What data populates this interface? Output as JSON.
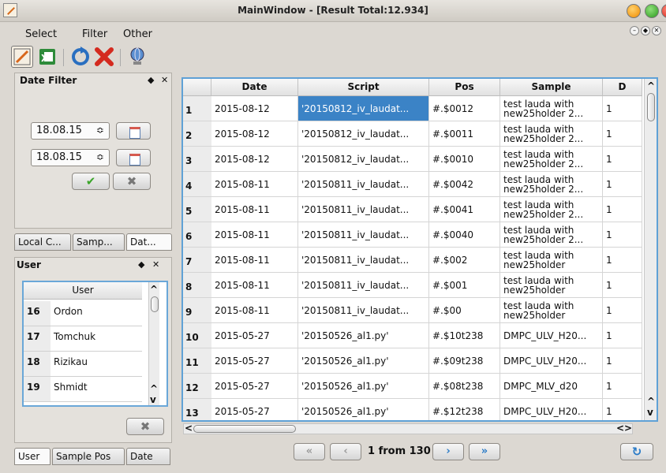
{
  "window": {
    "title": "MainWindow - [Result Total:12.934]"
  },
  "menu": [
    "Select",
    "Filter",
    "Other"
  ],
  "date_filter": {
    "title": "Date Filter",
    "from_date": "18.08.15",
    "to_date": "18.08.15",
    "apply_label": "✔",
    "clear_label": "✖"
  },
  "filter_tabs": [
    "Local C...",
    "Samp...",
    "Dat..."
  ],
  "user_panel": {
    "title": "User",
    "column": "User",
    "rows": [
      {
        "num": "16",
        "name": "Ordon"
      },
      {
        "num": "17",
        "name": "Tomchuk"
      },
      {
        "num": "18",
        "name": "Rizikau"
      },
      {
        "num": "19",
        "name": "Shmidt"
      }
    ],
    "clear_label": "✖"
  },
  "bottom_tabs": [
    "User",
    "Sample Pos",
    "Date"
  ],
  "table": {
    "columns": [
      "Date",
      "Script",
      "Pos",
      "Sample",
      "D"
    ],
    "rows": [
      {
        "num": "1",
        "date": "2015-08-12",
        "script": "'20150812_iv_laudat...",
        "pos": "#.$0012",
        "sample": "test lauda with new25holder 2...",
        "d": "1"
      },
      {
        "num": "2",
        "date": "2015-08-12",
        "script": "'20150812_iv_laudat...",
        "pos": "#.$0011",
        "sample": "test lauda with new25holder 2...",
        "d": "1"
      },
      {
        "num": "3",
        "date": "2015-08-12",
        "script": "'20150812_iv_laudat...",
        "pos": "#.$0010",
        "sample": "test lauda with new25holder 2...",
        "d": "1"
      },
      {
        "num": "4",
        "date": "2015-08-11",
        "script": "'20150811_iv_laudat...",
        "pos": "#.$0042",
        "sample": "test lauda with new25holder 2...",
        "d": "1"
      },
      {
        "num": "5",
        "date": "2015-08-11",
        "script": "'20150811_iv_laudat...",
        "pos": "#.$0041",
        "sample": "test lauda with new25holder 2...",
        "d": "1"
      },
      {
        "num": "6",
        "date": "2015-08-11",
        "script": "'20150811_iv_laudat...",
        "pos": "#.$0040",
        "sample": "test lauda with new25holder 2...",
        "d": "1"
      },
      {
        "num": "7",
        "date": "2015-08-11",
        "script": "'20150811_iv_laudat...",
        "pos": "#.$002",
        "sample": "test lauda with new25holder",
        "d": "1"
      },
      {
        "num": "8",
        "date": "2015-08-11",
        "script": "'20150811_iv_laudat...",
        "pos": "#.$001",
        "sample": "test lauda with new25holder",
        "d": "1"
      },
      {
        "num": "9",
        "date": "2015-08-11",
        "script": "'20150811_iv_laudat...",
        "pos": "#.$00",
        "sample": "test lauda with new25holder",
        "d": "1"
      },
      {
        "num": "10",
        "date": "2015-05-27",
        "script": "'20150526_al1.py'",
        "pos": "#.$10t238",
        "sample": "DMPC_ULV_H20...",
        "d": "1"
      },
      {
        "num": "11",
        "date": "2015-05-27",
        "script": "'20150526_al1.py'",
        "pos": "#.$09t238",
        "sample": "DMPC_ULV_H20...",
        "d": "1"
      },
      {
        "num": "12",
        "date": "2015-05-27",
        "script": "'20150526_al1.py'",
        "pos": "#.$08t238",
        "sample": "DMPC_MLV_d20",
        "d": "1"
      },
      {
        "num": "13",
        "date": "2015-05-27",
        "script": "'20150526_al1.py'",
        "pos": "#.$12t238",
        "sample": "DMPC_ULV_H20...",
        "d": "1"
      }
    ]
  },
  "pager": {
    "first_label": "«",
    "prev_label": "‹",
    "text": "1 from 130",
    "next_label": "›",
    "last_label": "»",
    "refresh_label": "↻"
  }
}
